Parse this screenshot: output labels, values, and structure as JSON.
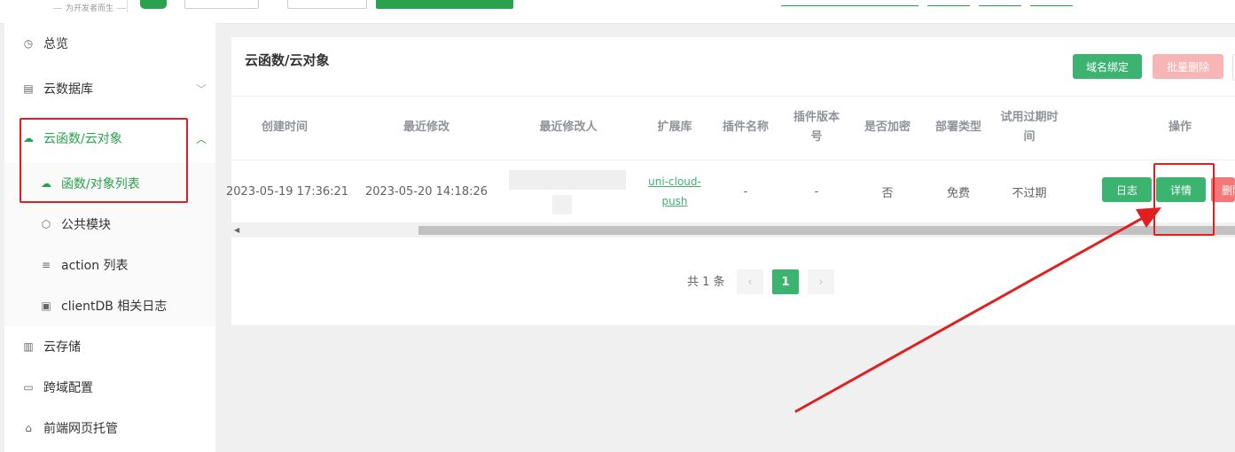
{
  "header": {
    "slogan": "为开发者而生"
  },
  "sidebar": {
    "items": [
      {
        "label": "总览",
        "icon": "clock-icon"
      },
      {
        "label": "云数据库",
        "icon": "database-icon"
      },
      {
        "label": "云函数/云对象",
        "icon": "cloud-icon"
      },
      {
        "label": "函数/对象列表",
        "icon": "cloud-icon"
      },
      {
        "label": "公共模块",
        "icon": "cube-icon"
      },
      {
        "label": "action 列表",
        "icon": "list-icon"
      },
      {
        "label": "clientDB 相关日志",
        "icon": "log-icon"
      },
      {
        "label": "云存储",
        "icon": "storage-icon"
      },
      {
        "label": "跨域配置",
        "icon": "monitor-icon"
      },
      {
        "label": "前端网页托管",
        "icon": "hosting-icon"
      }
    ]
  },
  "main": {
    "title": "云函数/云对象",
    "buttons": {
      "domain_bind": "域名绑定",
      "batch_delete": "批量删除"
    },
    "table": {
      "columns": [
        "创建时间",
        "最近修改",
        "最近修改人",
        "扩展库",
        "插件名称",
        "插件版本号",
        "是否加密",
        "部署类型",
        "试用过期时间",
        "操作"
      ],
      "rows": [
        {
          "created": "2023-05-19 17:36:21",
          "modified": "2023-05-20 14:18:26",
          "modifier": "",
          "extension": "uni-cloud-push",
          "plugin_name": "-",
          "plugin_version": "-",
          "encrypted": "否",
          "deploy_type": "免费",
          "trial_expire": "不过期",
          "actions": {
            "log": "日志",
            "detail": "详情",
            "delete": "删除"
          }
        }
      ]
    },
    "pagination": {
      "total": "共 1 条",
      "current_page": "1"
    }
  },
  "colors": {
    "brand_green": "#3cb371",
    "annotation_red": "#e02020",
    "danger_light": "#f7b5b5"
  }
}
